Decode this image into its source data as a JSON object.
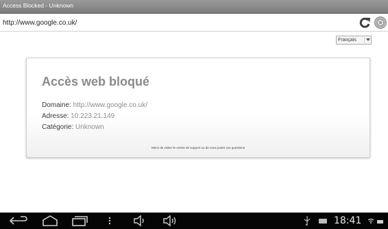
{
  "window": {
    "title": "Access Blocked - Unknown"
  },
  "address_bar": {
    "url": "http://www.google.co.uk/"
  },
  "language": {
    "selected": "Français"
  },
  "block_page": {
    "heading": "Accès web bloqué",
    "domain_label": "Domaine:",
    "domain_value": "http://www.google.co.uk/",
    "address_label": "Adresse:",
    "address_value": "10.223.21.149",
    "category_label": "Catégorie:",
    "category_value": "Unknown",
    "support_text": "Merci de visiter le centre de support ou de nous poser vos questions"
  },
  "status_bar": {
    "time": "18:41"
  },
  "icons": {
    "reload": "reload-icon",
    "settings": "settings-icon",
    "back": "back-icon",
    "home": "home-icon",
    "recent": "recent-apps-icon",
    "menu": "menu-icon",
    "volume_down": "volume-down-icon",
    "volume_up": "volume-up-icon",
    "usb": "usb-icon",
    "battery": "battery-icon"
  },
  "colors": {
    "title_bar": "#8a8a8a",
    "nav_bar": "#050505",
    "heading": "#8a8a8a",
    "value_text": "#8d8d8d"
  }
}
